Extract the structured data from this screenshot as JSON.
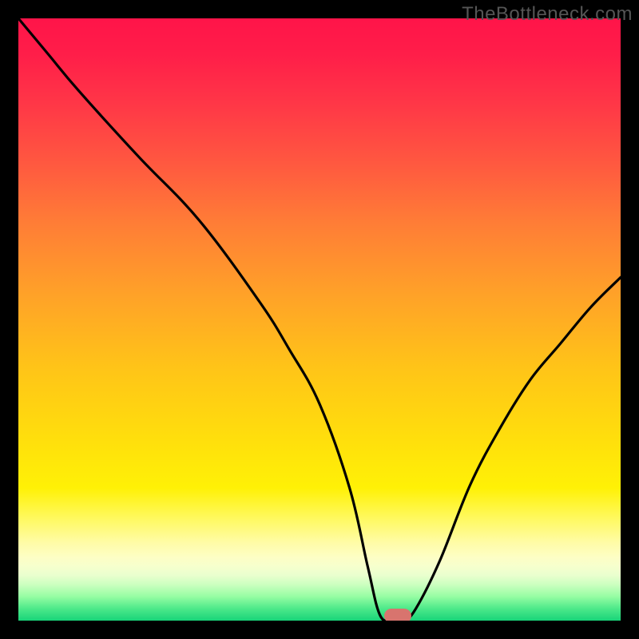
{
  "watermark": "TheBottleneck.com",
  "chart_data": {
    "type": "line",
    "title": "",
    "xlabel": "",
    "ylabel": "",
    "xlim": [
      0,
      100
    ],
    "ylim": [
      0,
      100
    ],
    "grid": false,
    "series": [
      {
        "name": "bottleneck-curve",
        "x": [
          0,
          5,
          10,
          20,
          30,
          40,
          45,
          50,
          55,
          58,
          60,
          62,
          64,
          66,
          70,
          75,
          80,
          85,
          90,
          95,
          100
        ],
        "values": [
          100,
          94,
          88,
          77,
          66.5,
          53,
          45,
          36,
          22,
          9,
          1,
          0,
          0,
          2,
          10,
          22.5,
          32,
          40,
          46,
          52,
          57
        ]
      }
    ],
    "marker": {
      "x": 63,
      "y": 0.8,
      "color": "#d8746e"
    },
    "gradient_colors": {
      "top": "#ff1449",
      "mid_high": "#ffa228",
      "mid": "#fff106",
      "mid_low": "#fdfec5",
      "bottom": "#18d479"
    }
  },
  "layout": {
    "image_size": 800,
    "plot_inset": 23,
    "plot_size": 754
  }
}
